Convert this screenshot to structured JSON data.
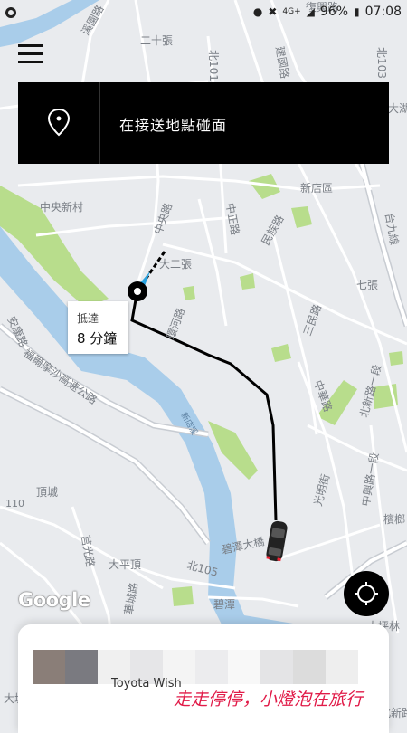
{
  "status_bar": {
    "network": "4G+",
    "battery": "96%",
    "time": "07:08"
  },
  "pickup_banner": {
    "label": "在接送地點碰面",
    "icon": "location-pin-icon"
  },
  "eta": {
    "label": "抵達",
    "value": "8 分鐘"
  },
  "map": {
    "labels": {
      "l1": "二十張",
      "l2": "北101",
      "l3": "北103",
      "l4": "溪園路",
      "l5": "建國路",
      "l6": "復興路",
      "l7": "中央新村",
      "l8": "新店區",
      "l9": "中央路",
      "l10": "中正路",
      "l11": "民族路",
      "l12": "台九線",
      "l13": "七張",
      "l14": "大二張",
      "l15": "三民路",
      "l16": "環河路",
      "l17": "中華路",
      "l18": "北新路一段",
      "l19": "安康路",
      "l20": "福爾摩沙高速公路",
      "l21": "新店溪",
      "l22": "頂城",
      "l23": "110",
      "l24": "光明街",
      "l25": "中興路一段",
      "l26": "檳榔",
      "l27": "碧潭大橋",
      "l28": "大平頂",
      "l29": "北105",
      "l30": "華城路",
      "l31": "碧潭",
      "l32": "大湖",
      "l33": "大城",
      "l34": "莒光路",
      "l35": "大坪林",
      "l36": "北新路三段"
    },
    "attribution": "Google",
    "colors": {
      "route": "#000000",
      "river": "#a9cdea",
      "park": "#b8dd8c",
      "road": "#ffffff",
      "road_major": "#c8ccd2"
    }
  },
  "bottom_card": {
    "car_name": "Toyota Wish"
  },
  "watermark": {
    "text": "走走停停，小燈泡在旅行"
  }
}
